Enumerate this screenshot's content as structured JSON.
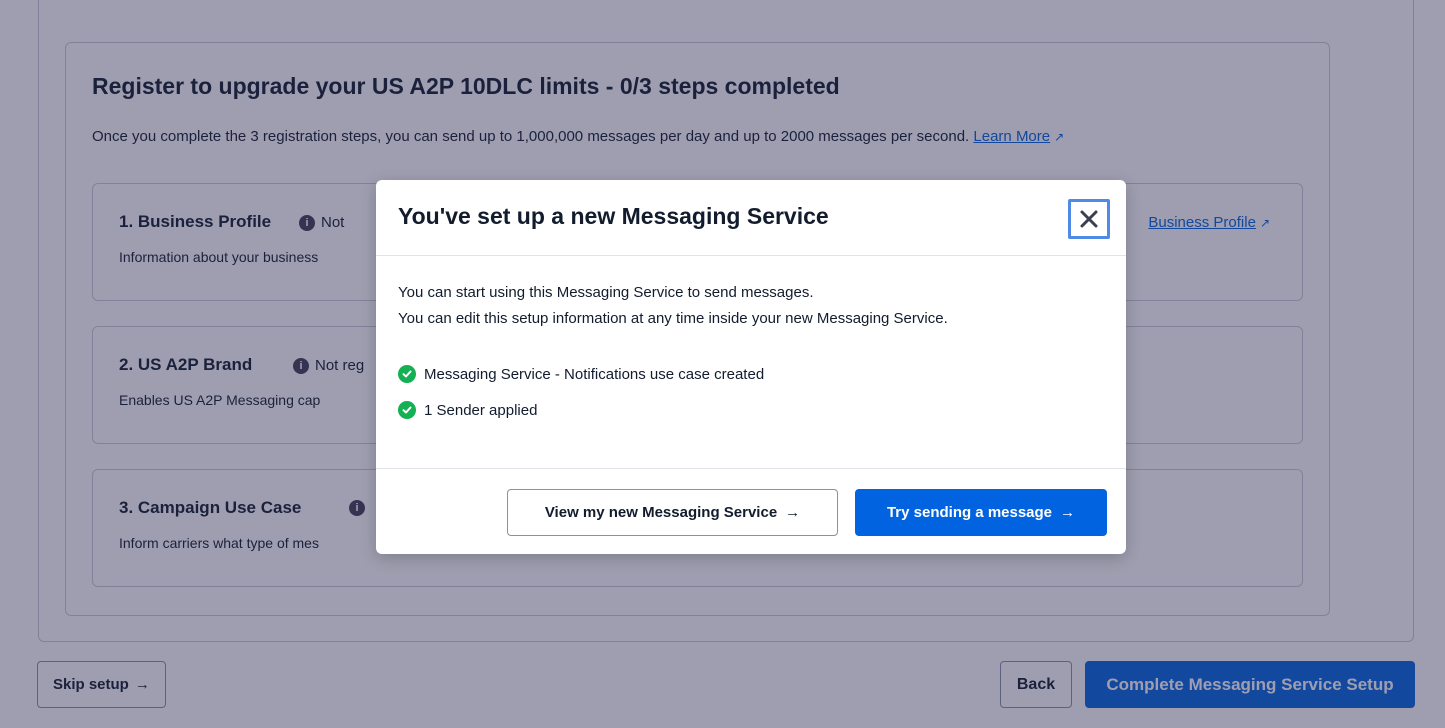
{
  "page": {
    "registration": {
      "title": "Register to upgrade your US A2P 10DLC limits - 0/3 steps completed",
      "description": "Once you complete the 3 registration steps, you can send up to 1,000,000 messages per day and up to 2000 messages per second.",
      "learn_more": "Learn More"
    },
    "steps": [
      {
        "title": "1. Business Profile",
        "status": "Not",
        "description": "Information about your business",
        "link": "Business Profile"
      },
      {
        "title": "2. US A2P Brand",
        "status": "Not reg",
        "description": "Enables US A2P Messaging cap"
      },
      {
        "title": "3. Campaign Use Case",
        "status": "",
        "description": "Inform carriers what type of mes"
      }
    ],
    "footer": {
      "skip": "Skip setup",
      "back": "Back",
      "complete": "Complete Messaging Service Setup"
    }
  },
  "modal": {
    "title": "You've set up a new Messaging Service",
    "body_line_1": "You can start using this Messaging Service to send messages.",
    "body_line_2": "You can edit this setup information at any time inside your new Messaging Service.",
    "checks": [
      "Messaging Service - Notifications use case created",
      "1 Sender applied"
    ],
    "view_button": "View my new Messaging Service",
    "try_button": "Try sending a message"
  },
  "icons": {
    "close": "close-icon",
    "check": "check-circle-icon",
    "info": "info-icon",
    "arrow": "arrow-right-icon",
    "external": "external-link-icon"
  },
  "colors": {
    "primary": "#0263e0",
    "success": "#14b053",
    "focus_ring": "#4f8ae6"
  }
}
